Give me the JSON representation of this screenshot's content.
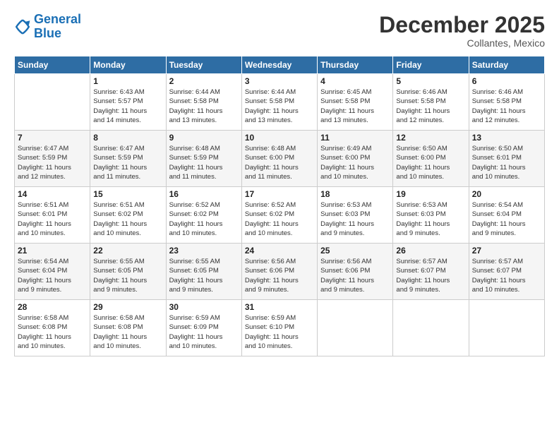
{
  "header": {
    "logo_line1": "General",
    "logo_line2": "Blue",
    "main_title": "December 2025",
    "sub_title": "Collantes, Mexico"
  },
  "calendar": {
    "days_of_week": [
      "Sunday",
      "Monday",
      "Tuesday",
      "Wednesday",
      "Thursday",
      "Friday",
      "Saturday"
    ],
    "weeks": [
      [
        {
          "day": "",
          "text": ""
        },
        {
          "day": "1",
          "text": "Sunrise: 6:43 AM\nSunset: 5:57 PM\nDaylight: 11 hours\nand 14 minutes."
        },
        {
          "day": "2",
          "text": "Sunrise: 6:44 AM\nSunset: 5:58 PM\nDaylight: 11 hours\nand 13 minutes."
        },
        {
          "day": "3",
          "text": "Sunrise: 6:44 AM\nSunset: 5:58 PM\nDaylight: 11 hours\nand 13 minutes."
        },
        {
          "day": "4",
          "text": "Sunrise: 6:45 AM\nSunset: 5:58 PM\nDaylight: 11 hours\nand 13 minutes."
        },
        {
          "day": "5",
          "text": "Sunrise: 6:46 AM\nSunset: 5:58 PM\nDaylight: 11 hours\nand 12 minutes."
        },
        {
          "day": "6",
          "text": "Sunrise: 6:46 AM\nSunset: 5:58 PM\nDaylight: 11 hours\nand 12 minutes."
        }
      ],
      [
        {
          "day": "7",
          "text": "Sunrise: 6:47 AM\nSunset: 5:59 PM\nDaylight: 11 hours\nand 12 minutes."
        },
        {
          "day": "8",
          "text": "Sunrise: 6:47 AM\nSunset: 5:59 PM\nDaylight: 11 hours\nand 11 minutes."
        },
        {
          "day": "9",
          "text": "Sunrise: 6:48 AM\nSunset: 5:59 PM\nDaylight: 11 hours\nand 11 minutes."
        },
        {
          "day": "10",
          "text": "Sunrise: 6:48 AM\nSunset: 6:00 PM\nDaylight: 11 hours\nand 11 minutes."
        },
        {
          "day": "11",
          "text": "Sunrise: 6:49 AM\nSunset: 6:00 PM\nDaylight: 11 hours\nand 10 minutes."
        },
        {
          "day": "12",
          "text": "Sunrise: 6:50 AM\nSunset: 6:00 PM\nDaylight: 11 hours\nand 10 minutes."
        },
        {
          "day": "13",
          "text": "Sunrise: 6:50 AM\nSunset: 6:01 PM\nDaylight: 11 hours\nand 10 minutes."
        }
      ],
      [
        {
          "day": "14",
          "text": "Sunrise: 6:51 AM\nSunset: 6:01 PM\nDaylight: 11 hours\nand 10 minutes."
        },
        {
          "day": "15",
          "text": "Sunrise: 6:51 AM\nSunset: 6:02 PM\nDaylight: 11 hours\nand 10 minutes."
        },
        {
          "day": "16",
          "text": "Sunrise: 6:52 AM\nSunset: 6:02 PM\nDaylight: 11 hours\nand 10 minutes."
        },
        {
          "day": "17",
          "text": "Sunrise: 6:52 AM\nSunset: 6:02 PM\nDaylight: 11 hours\nand 10 minutes."
        },
        {
          "day": "18",
          "text": "Sunrise: 6:53 AM\nSunset: 6:03 PM\nDaylight: 11 hours\nand 9 minutes."
        },
        {
          "day": "19",
          "text": "Sunrise: 6:53 AM\nSunset: 6:03 PM\nDaylight: 11 hours\nand 9 minutes."
        },
        {
          "day": "20",
          "text": "Sunrise: 6:54 AM\nSunset: 6:04 PM\nDaylight: 11 hours\nand 9 minutes."
        }
      ],
      [
        {
          "day": "21",
          "text": "Sunrise: 6:54 AM\nSunset: 6:04 PM\nDaylight: 11 hours\nand 9 minutes."
        },
        {
          "day": "22",
          "text": "Sunrise: 6:55 AM\nSunset: 6:05 PM\nDaylight: 11 hours\nand 9 minutes."
        },
        {
          "day": "23",
          "text": "Sunrise: 6:55 AM\nSunset: 6:05 PM\nDaylight: 11 hours\nand 9 minutes."
        },
        {
          "day": "24",
          "text": "Sunrise: 6:56 AM\nSunset: 6:06 PM\nDaylight: 11 hours\nand 9 minutes."
        },
        {
          "day": "25",
          "text": "Sunrise: 6:56 AM\nSunset: 6:06 PM\nDaylight: 11 hours\nand 9 minutes."
        },
        {
          "day": "26",
          "text": "Sunrise: 6:57 AM\nSunset: 6:07 PM\nDaylight: 11 hours\nand 9 minutes."
        },
        {
          "day": "27",
          "text": "Sunrise: 6:57 AM\nSunset: 6:07 PM\nDaylight: 11 hours\nand 10 minutes."
        }
      ],
      [
        {
          "day": "28",
          "text": "Sunrise: 6:58 AM\nSunset: 6:08 PM\nDaylight: 11 hours\nand 10 minutes."
        },
        {
          "day": "29",
          "text": "Sunrise: 6:58 AM\nSunset: 6:08 PM\nDaylight: 11 hours\nand 10 minutes."
        },
        {
          "day": "30",
          "text": "Sunrise: 6:59 AM\nSunset: 6:09 PM\nDaylight: 11 hours\nand 10 minutes."
        },
        {
          "day": "31",
          "text": "Sunrise: 6:59 AM\nSunset: 6:10 PM\nDaylight: 11 hours\nand 10 minutes."
        },
        {
          "day": "",
          "text": ""
        },
        {
          "day": "",
          "text": ""
        },
        {
          "day": "",
          "text": ""
        }
      ]
    ]
  }
}
